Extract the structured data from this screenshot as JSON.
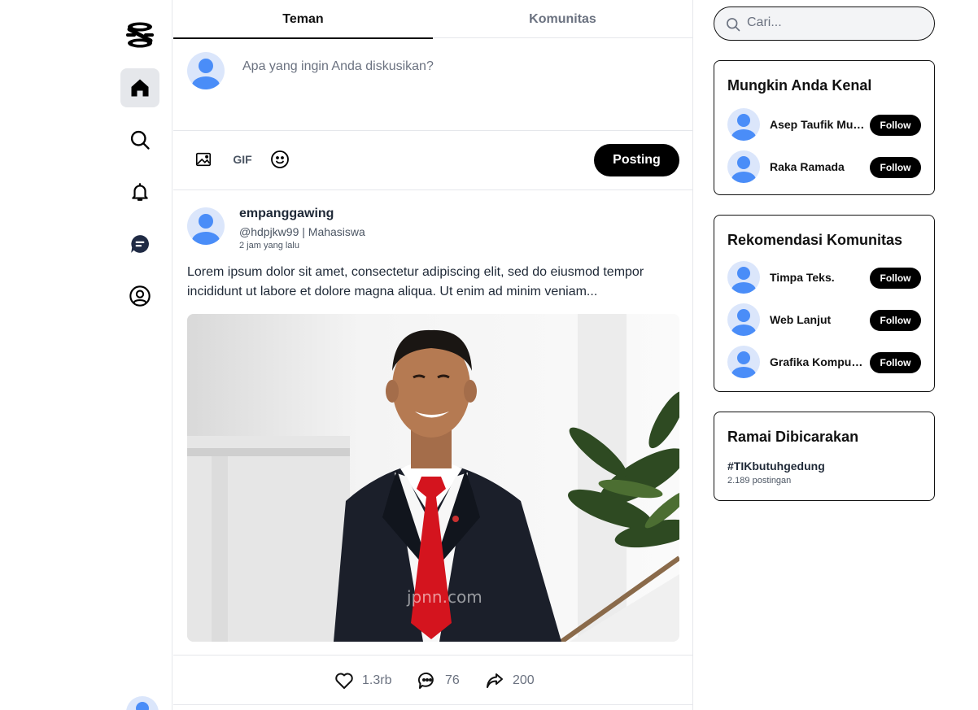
{
  "nav": {
    "items": [
      "home",
      "search",
      "notifications",
      "messages",
      "profile"
    ]
  },
  "tabs": [
    {
      "label": "Teman",
      "active": true
    },
    {
      "label": "Komunitas",
      "active": false
    }
  ],
  "composer": {
    "placeholder": "Apa yang ingin Anda diskusikan?",
    "gif_label": "GIF",
    "post_button": "Posting"
  },
  "post": {
    "author_name": "empanggawing",
    "author_meta": "@hdpjkw99 | Mahasiswa",
    "time": "2 jam yang lalu",
    "text": "Lorem ipsum dolor sit amet, consectetur adipiscing elit, sed do eiusmod tempor incididunt ut labore et dolore magna aliqua. Ut enim ad minim veniam...",
    "image_watermark": "jpnn.com",
    "likes": "1.3rb",
    "comments": "76",
    "shares": "200"
  },
  "search": {
    "placeholder": "Cari..."
  },
  "people_card": {
    "title": "Mungkin Anda Kenal",
    "items": [
      {
        "name": "Asep Taufik Muh...",
        "button": "Follow"
      },
      {
        "name": "Raka Ramada",
        "button": "Follow"
      }
    ]
  },
  "community_card": {
    "title": "Rekomendasi Komunitas",
    "items": [
      {
        "name": "Timpa Teks.",
        "button": "Follow"
      },
      {
        "name": "Web Lanjut",
        "button": "Follow"
      },
      {
        "name": "Grafika Komputer",
        "button": "Follow"
      }
    ]
  },
  "trending_card": {
    "title": "Ramai Dibicarakan",
    "tag": "#TIKbutuhgedung",
    "count": "2.189 postingan"
  },
  "colors": {
    "accent": "#000000",
    "avatar_bg": "#dbe6fb",
    "avatar_fg": "#4a8df8",
    "border": "#e5e7eb"
  }
}
